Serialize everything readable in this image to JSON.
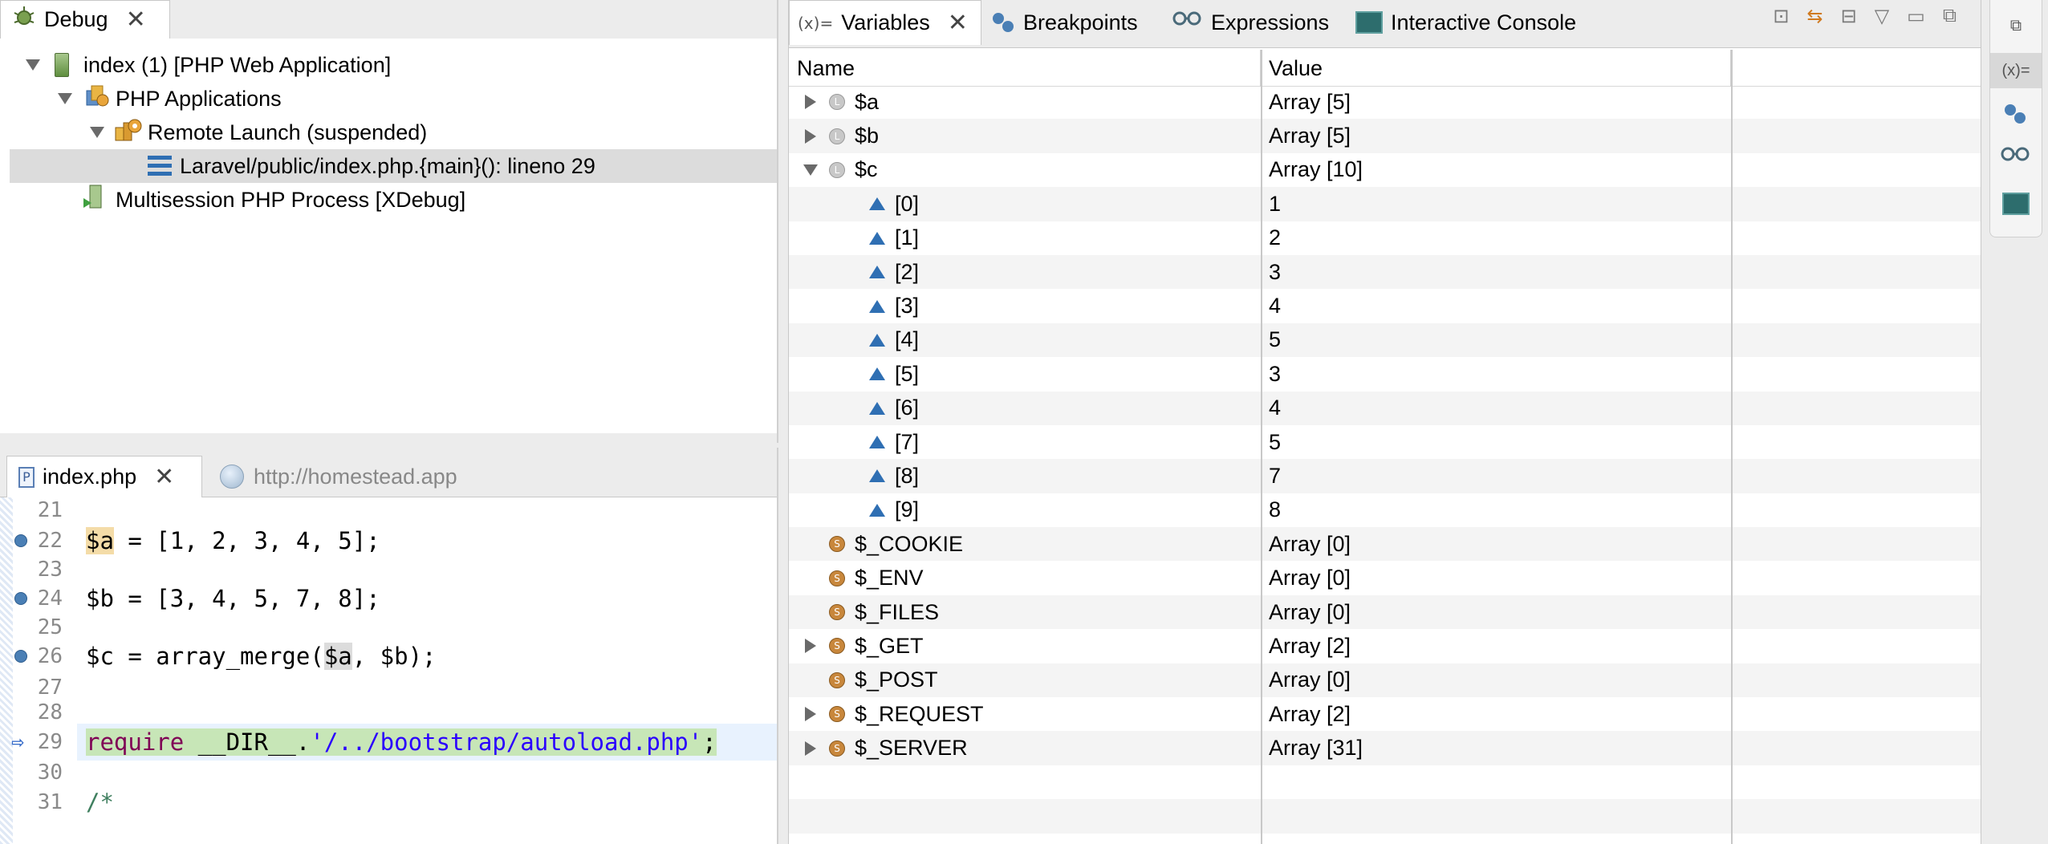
{
  "debug_view": {
    "tab_label": "Debug",
    "tree": [
      {
        "label": "index (1) [PHP Web Application]",
        "icon": "server-icon",
        "expanded": true,
        "depth": 0
      },
      {
        "label": "PHP Applications",
        "icon": "php-applications-icon",
        "expanded": true,
        "depth": 1
      },
      {
        "label": "Remote Launch (suspended)",
        "icon": "remote-launch-icon",
        "expanded": true,
        "depth": 2
      },
      {
        "label": "Laravel/public/index.php.{main}(): lineno 29",
        "icon": "stack-frame-icon",
        "depth": 3,
        "selected": true
      },
      {
        "label": "Multisession PHP Process [XDebug]",
        "icon": "process-icon",
        "depth": 1
      }
    ]
  },
  "editor": {
    "file_tab": "index.php",
    "browser_tab": "http://homestead.app",
    "lines": [
      {
        "num": "21",
        "code": ""
      },
      {
        "num": "22",
        "code": "$a = [1, 2, 3, 4, 5];",
        "breakpoint": true
      },
      {
        "num": "23",
        "code": ""
      },
      {
        "num": "24",
        "code": "$b = [3, 4, 5, 7, 8];",
        "breakpoint": true
      },
      {
        "num": "25",
        "code": ""
      },
      {
        "num": "26",
        "code": "$c = array_merge($a, $b);",
        "breakpoint": true
      },
      {
        "num": "27",
        "code": ""
      },
      {
        "num": "28",
        "code": ""
      },
      {
        "num": "29",
        "code": "require __DIR__.'/../bootstrap/autoload.php';",
        "current": true
      },
      {
        "num": "30",
        "code": ""
      },
      {
        "num": "31",
        "code": "/*"
      }
    ]
  },
  "variables_view": {
    "tabs": {
      "variables": "Variables",
      "variables_icon_text": "(x)=",
      "breakpoints": "Breakpoints",
      "expressions": "Expressions",
      "console": "Interactive Console"
    },
    "columns": {
      "name": "Name",
      "value": "Value"
    },
    "rows": [
      {
        "name": "$a",
        "value": "Array [5]",
        "kind": "local",
        "toggle": "collapsed",
        "depth": 0
      },
      {
        "name": "$b",
        "value": "Array [5]",
        "kind": "local",
        "toggle": "collapsed",
        "depth": 0
      },
      {
        "name": "$c",
        "value": "Array [10]",
        "kind": "local",
        "toggle": "expanded",
        "depth": 0
      },
      {
        "name": "[0]",
        "value": "1",
        "kind": "element",
        "depth": 1
      },
      {
        "name": "[1]",
        "value": "2",
        "kind": "element",
        "depth": 1
      },
      {
        "name": "[2]",
        "value": "3",
        "kind": "element",
        "depth": 1
      },
      {
        "name": "[3]",
        "value": "4",
        "kind": "element",
        "depth": 1
      },
      {
        "name": "[4]",
        "value": "5",
        "kind": "element",
        "depth": 1
      },
      {
        "name": "[5]",
        "value": "3",
        "kind": "element",
        "depth": 1
      },
      {
        "name": "[6]",
        "value": "4",
        "kind": "element",
        "depth": 1
      },
      {
        "name": "[7]",
        "value": "5",
        "kind": "element",
        "depth": 1
      },
      {
        "name": "[8]",
        "value": "7",
        "kind": "element",
        "depth": 1
      },
      {
        "name": "[9]",
        "value": "8",
        "kind": "element",
        "depth": 1
      },
      {
        "name": "$_COOKIE",
        "value": "Array [0]",
        "kind": "superglobal",
        "depth": 0
      },
      {
        "name": "$_ENV",
        "value": "Array [0]",
        "kind": "superglobal",
        "depth": 0
      },
      {
        "name": "$_FILES",
        "value": "Array [0]",
        "kind": "superglobal",
        "depth": 0
      },
      {
        "name": "$_GET",
        "value": "Array [2]",
        "kind": "superglobal",
        "toggle": "collapsed",
        "depth": 0
      },
      {
        "name": "$_POST",
        "value": "Array [0]",
        "kind": "superglobal",
        "depth": 0
      },
      {
        "name": "$_REQUEST",
        "value": "Array [2]",
        "kind": "superglobal",
        "toggle": "collapsed",
        "depth": 0
      },
      {
        "name": "$_SERVER",
        "value": "Array [31]",
        "kind": "superglobal",
        "toggle": "collapsed",
        "depth": 0
      }
    ]
  },
  "trim_bar": {
    "variables_icon_text": "(x)="
  },
  "colors": {
    "selection": "#dcdcdc",
    "current_line": "#c7e6b7",
    "keyword": "#7f0055",
    "string": "#2a00ff",
    "breakpoint": "#4a7fb5"
  }
}
